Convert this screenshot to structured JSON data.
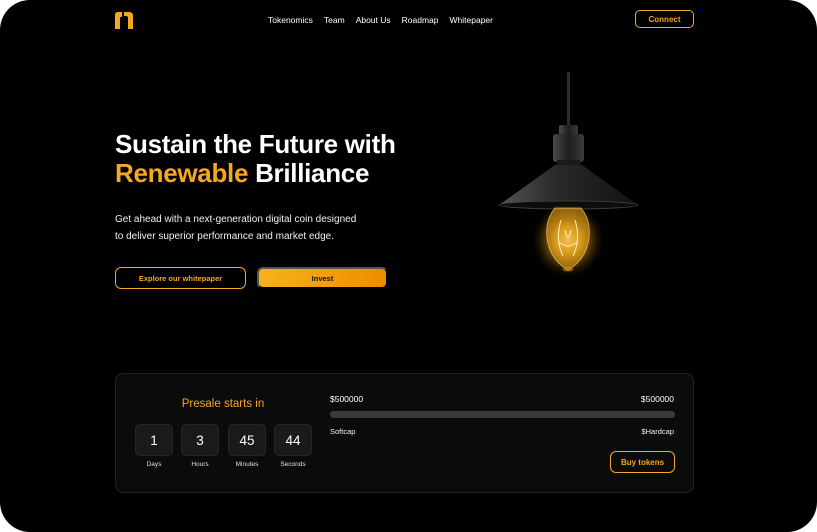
{
  "nav": {
    "items": [
      "Tokenomics",
      "Team",
      "About Us",
      "Roadmap",
      "Whitepaper"
    ],
    "connect_label": "Connect"
  },
  "hero": {
    "title_line1": "Sustain the Future with",
    "title_accent": "Renewable",
    "title_rest": " Brilliance",
    "subtitle_line1": "Get ahead with a next-generation digital coin designed",
    "subtitle_line2": "to deliver superior performance and market edge.",
    "whitepaper_button": "Explore our whitepaper",
    "invest_button": "Invest"
  },
  "presale": {
    "title": "Presale starts in",
    "countdown": [
      {
        "value": "1",
        "label": "Days"
      },
      {
        "value": "3",
        "label": "Hours"
      },
      {
        "value": "45",
        "label": "Minutes"
      },
      {
        "value": "44",
        "label": "Seconds"
      }
    ],
    "amount_left": "$500000",
    "amount_right": "$500000",
    "progress": 0,
    "softcap_label": "Softcap",
    "hardcap_label": "$Hardcap",
    "buy_button": "Buy tokens"
  },
  "colors": {
    "accent": "#f5a623",
    "background": "#000000"
  },
  "icons": {
    "logo": "brand-logo-icon",
    "lamp": "light-bulb-lamp-image"
  }
}
